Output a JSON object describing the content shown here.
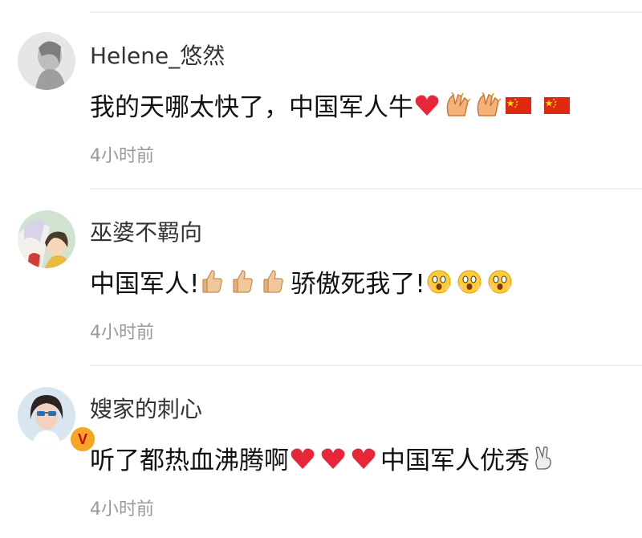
{
  "comments": [
    {
      "username": "Helene_悠然",
      "avatar_icon": "woman-portrait-avatar",
      "content": [
        {
          "text": "我的天哪太快了，中国军人牛"
        },
        {
          "emoji": "heart-icon"
        },
        {
          "emoji": "clapping-hands-icon"
        },
        {
          "emoji": "clapping-hands-icon"
        },
        {
          "emoji": "china-flag-icon"
        },
        {
          "emoji": "china-flag-icon"
        }
      ],
      "timestamp": "4小时前"
    },
    {
      "username": "巫婆不羁向",
      "avatar_icon": "anime-characters-avatar",
      "content": [
        {
          "text": "中国军人!"
        },
        {
          "emoji": "thumbs-up-icon"
        },
        {
          "emoji": "thumbs-up-icon"
        },
        {
          "emoji": "thumbs-up-icon"
        },
        {
          "text": "骄傲死我了!"
        },
        {
          "emoji": "shocked-face-icon"
        },
        {
          "emoji": "shocked-face-icon"
        },
        {
          "emoji": "shocked-face-icon"
        }
      ],
      "timestamp": "4小时前"
    },
    {
      "username": "嫂家的刺心",
      "avatar_icon": "woman-sunglasses-avatar",
      "verified_badge": "V",
      "content": [
        {
          "text": "听了都热血沸腾啊"
        },
        {
          "emoji": "heart-icon"
        },
        {
          "emoji": "heart-icon"
        },
        {
          "emoji": "heart-icon"
        },
        {
          "text": "中国军人优秀"
        },
        {
          "emoji": "victory-hand-icon"
        }
      ],
      "timestamp": "4小时前"
    }
  ],
  "colors": {
    "divider": "#eeeeee",
    "username": "#333333",
    "content": "#111111",
    "timestamp": "#9a9a9a",
    "heart": "#e8263a",
    "flag_red": "#de2910",
    "flag_star": "#ffde00",
    "badge": "#f5a623"
  }
}
